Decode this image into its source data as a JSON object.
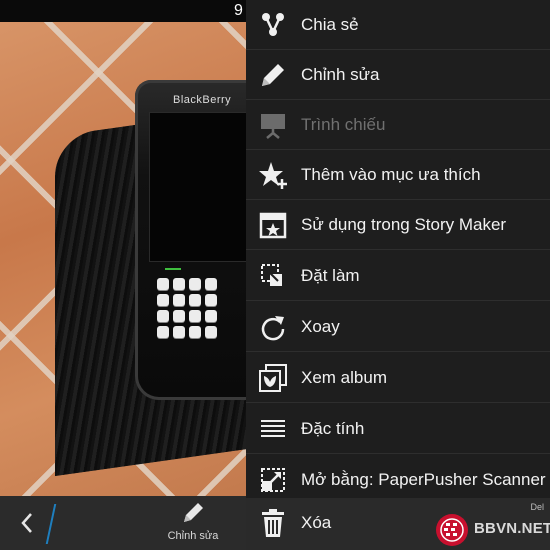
{
  "status_bar": {
    "clock_fragment": "9"
  },
  "photo": {
    "brand_text": "BlackBerry"
  },
  "bottom_bar": {
    "back_icon": "chevron-left-icon",
    "edit_label": "Chỉnh sửa",
    "edit_icon": "pencil-icon",
    "divider_color": "#1e7fbf"
  },
  "menu": {
    "items": [
      {
        "label": "Chia sẻ",
        "icon": "share-icon",
        "enabled": true
      },
      {
        "label": "Chỉnh sửa",
        "icon": "pencil-icon",
        "enabled": true
      },
      {
        "label": "Trình chiếu",
        "icon": "slideshow-icon",
        "enabled": false
      },
      {
        "label": "Thêm vào mục ưa thích",
        "icon": "star-add-icon",
        "enabled": true
      },
      {
        "label": "Sử dụng trong Story Maker",
        "icon": "film-icon",
        "enabled": true
      },
      {
        "label": "Đặt làm",
        "icon": "set-as-icon",
        "enabled": true
      },
      {
        "label": "Xoay",
        "icon": "rotate-icon",
        "enabled": true
      },
      {
        "label": "Xem album",
        "icon": "album-icon",
        "enabled": true
      },
      {
        "label": "Đặc tính",
        "icon": "properties-icon",
        "enabled": true
      },
      {
        "label": "Mở bằng: PaperPusher Scanner",
        "icon": "open-with-icon",
        "enabled": true
      }
    ],
    "delete": {
      "label": "Xóa",
      "icon": "trash-icon",
      "hint": "Del"
    }
  },
  "watermark": {
    "text": "BBVN.NET",
    "logo_color": "#c8102e"
  }
}
